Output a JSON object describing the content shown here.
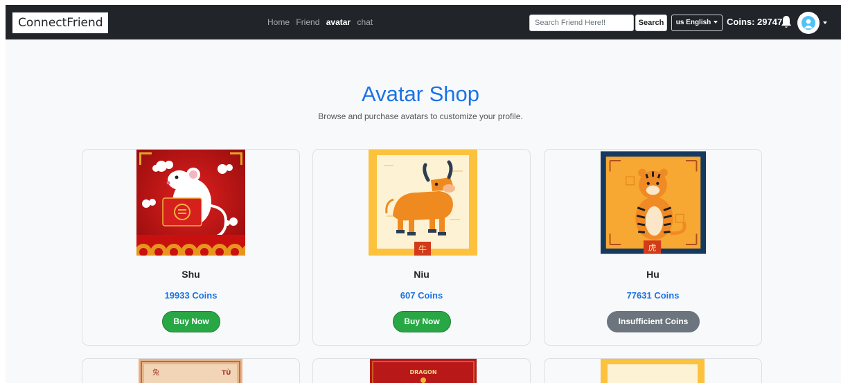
{
  "nav": {
    "brand": "ConnectFriend",
    "links": [
      {
        "label": "Home",
        "active": false
      },
      {
        "label": "Friend",
        "active": false
      },
      {
        "label": "avatar",
        "active": true
      },
      {
        "label": "chat",
        "active": false
      }
    ],
    "search_placeholder": "Search Friend Here!!",
    "search_button": "Search",
    "language": "us English",
    "coins_text": "Coins: 29747"
  },
  "page": {
    "title": "Avatar Shop",
    "subtitle": "Browse and purchase avatars to customize your profile."
  },
  "avatars": [
    {
      "name": "Shu",
      "price": "19933 Coins",
      "action": "Buy Now",
      "affordable": true
    },
    {
      "name": "Niu",
      "price": "607 Coins",
      "action": "Buy Now",
      "affordable": true
    },
    {
      "name": "Hu",
      "price": "77631 Coins",
      "action": "Insufficient Coins",
      "affordable": false
    }
  ],
  "partial_cards": {
    "left_label_1": "兔",
    "left_label_2": "TÙ",
    "middle_label": "DRAGON"
  },
  "colors": {
    "navbar": "#212529",
    "accent": "#1a73e8",
    "buy": "#28a745",
    "disabled": "#6c757d"
  }
}
